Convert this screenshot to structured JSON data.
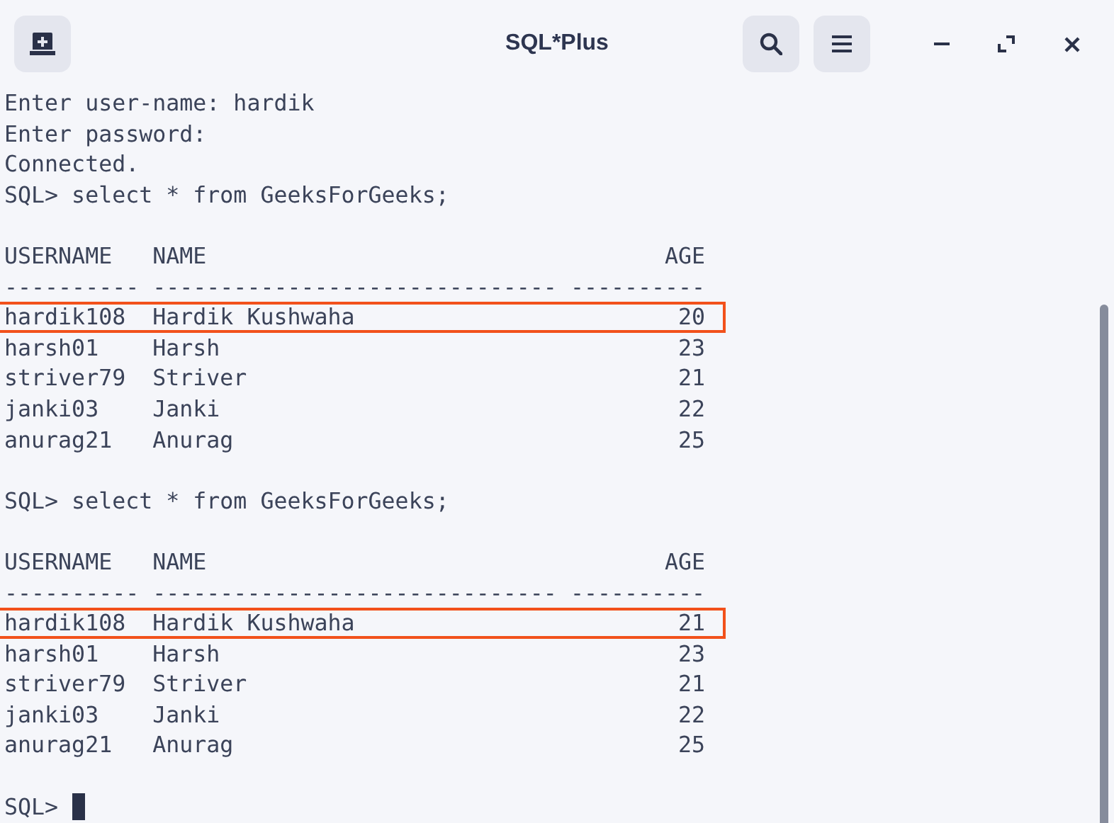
{
  "window": {
    "title": "SQL*Plus"
  },
  "terminal": {
    "lines": [
      {
        "kind": "text",
        "text": "Enter user-name: hardik"
      },
      {
        "kind": "text",
        "text": "Enter password:"
      },
      {
        "kind": "text",
        "text": "Connected."
      },
      {
        "kind": "text",
        "text": "SQL> select * from GeeksForGeeks;"
      },
      {
        "kind": "blank"
      },
      {
        "kind": "text",
        "text": "USERNAME   NAME                                  AGE"
      },
      {
        "kind": "text",
        "text": "---------- ------------------------------ ----------"
      },
      {
        "kind": "text",
        "text": "hardik108  Hardik Kushwaha                        20",
        "highlighted": true
      },
      {
        "kind": "text",
        "text": "harsh01    Harsh                                  23",
        "highlighted": false
      },
      {
        "kind": "text",
        "text": "striver79  Striver                                21",
        "highlighted": false
      },
      {
        "kind": "text",
        "text": "janki03    Janki                                  22",
        "highlighted": false
      },
      {
        "kind": "text",
        "text": "anurag21   Anurag                                 25",
        "highlighted": false
      },
      {
        "kind": "blank"
      },
      {
        "kind": "text",
        "text": "SQL> select * from GeeksForGeeks;"
      },
      {
        "kind": "blank"
      },
      {
        "kind": "text",
        "text": "USERNAME   NAME                                  AGE"
      },
      {
        "kind": "text",
        "text": "---------- ------------------------------ ----------"
      },
      {
        "kind": "text",
        "text": "hardik108  Hardik Kushwaha                        21",
        "highlighted": true
      },
      {
        "kind": "text",
        "text": "harsh01    Harsh                                  23",
        "highlighted": false
      },
      {
        "kind": "text",
        "text": "striver79  Striver                                21",
        "highlighted": false
      },
      {
        "kind": "text",
        "text": "janki03    Janki                                  22",
        "highlighted": false
      },
      {
        "kind": "text",
        "text": "anurag21   Anurag                                 25",
        "highlighted": false
      },
      {
        "kind": "blank"
      },
      {
        "kind": "prompt",
        "text": "SQL>"
      }
    ]
  }
}
